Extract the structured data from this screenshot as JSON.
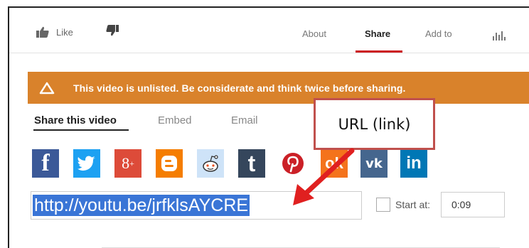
{
  "topbar": {
    "like_label": "Like",
    "tabs": [
      {
        "label": "About",
        "active": false
      },
      {
        "label": "Share",
        "active": true
      },
      {
        "label": "Add to",
        "active": false
      }
    ],
    "accent_color": "#cc181e"
  },
  "banner": {
    "text": "This video is unlisted. Be considerate and think twice before sharing.",
    "color": "#d9822b"
  },
  "share_tabs": [
    {
      "label": "Share this video",
      "active": true
    },
    {
      "label": "Embed",
      "active": false
    },
    {
      "label": "Email",
      "active": false
    }
  ],
  "social": [
    {
      "name": "facebook-icon",
      "glyph": "f",
      "color": "#3b5998"
    },
    {
      "name": "twitter-icon",
      "glyph": "🐦",
      "color": "#1da1f2"
    },
    {
      "name": "google-plus-icon",
      "glyph": "8+",
      "color": "#dd4b39"
    },
    {
      "name": "blogger-icon",
      "glyph": "B",
      "color": "#f57d00"
    },
    {
      "name": "reddit-icon",
      "glyph": "👽",
      "color": "#cee3f8"
    },
    {
      "name": "tumblr-icon",
      "glyph": "t",
      "color": "#35465c"
    },
    {
      "name": "pinterest-icon",
      "glyph": "P",
      "color": "#cb2027"
    },
    {
      "name": "odnoklassniki-icon",
      "glyph": "ok",
      "color": "#f4731c"
    },
    {
      "name": "vk-icon",
      "glyph": "vk",
      "color": "#45668e"
    },
    {
      "name": "linkedin-icon",
      "glyph": "in",
      "color": "#0077b5"
    }
  ],
  "url_field": {
    "value": "http://youtu.be/jrfklsAYCRE",
    "selection_color": "#3a75d6"
  },
  "start_at": {
    "label": "Start at:",
    "value": "0:09",
    "checked": false
  },
  "annotation": {
    "label": "URL (link)",
    "border_color": "#c0504d",
    "arrow_color": "#e02020"
  }
}
